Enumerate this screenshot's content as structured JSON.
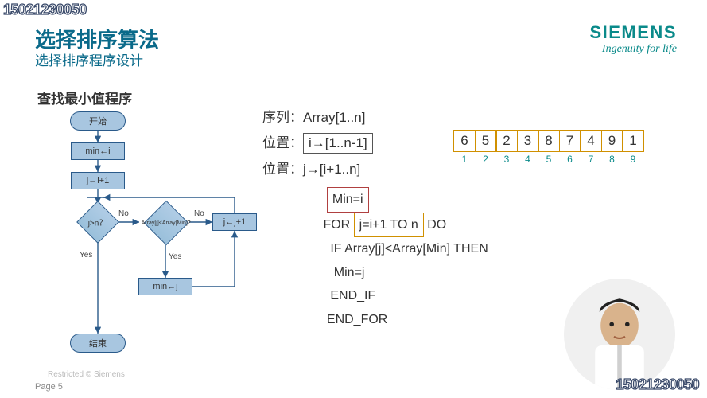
{
  "watermark": "15021230050",
  "title": "选择排序算法",
  "subtitle": "选择排序程序设计",
  "section_label": "查找最小值程序",
  "logo": {
    "name": "SIEMENS",
    "tagline": "Ingenuity for life"
  },
  "definitions": {
    "line1_label": "序列：",
    "line1_value": "Array[1..n]",
    "line2_label": "位置：",
    "line2_value": "i→[1..n-1]",
    "line3_label": "位置：",
    "line3_value": "j→[i+1..n]"
  },
  "array": {
    "values": [
      6,
      5,
      2,
      3,
      8,
      7,
      4,
      9,
      1
    ],
    "indices": [
      1,
      2,
      3,
      4,
      5,
      6,
      7,
      8,
      9
    ]
  },
  "pseudocode": {
    "l1": "Min=i",
    "l2a": "FOR ",
    "l2b": "j=i+1 TO n",
    "l2c": " DO",
    "l3": "IF Array[j]<Array[Min] THEN",
    "l4": "Min=j",
    "l5": "END_IF",
    "l6": "END_FOR"
  },
  "flowchart": {
    "start": "开始",
    "p1": "min←i",
    "p2": "j←i+1",
    "d1": "j>n？",
    "d2": "Array[j]<Array[Min]?",
    "p3": "j←j+1",
    "p4": "min←j",
    "end": "结束",
    "yes": "Yes",
    "no": "No"
  },
  "footer": {
    "restricted": "Restricted © Siemens",
    "page": "Page 5"
  }
}
